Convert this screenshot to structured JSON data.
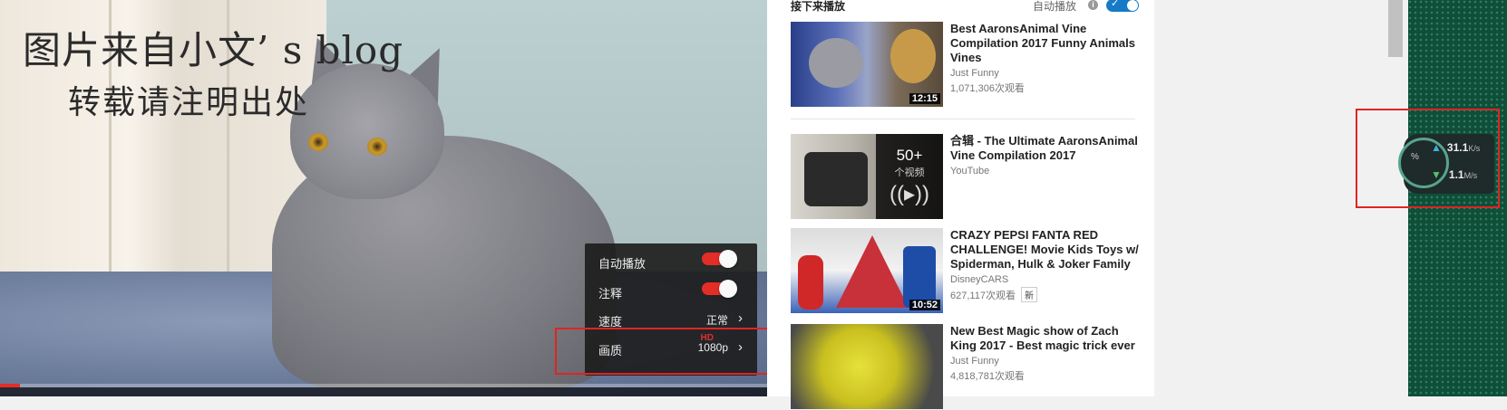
{
  "watermark": {
    "line1": "图片来自小文’ s blog",
    "line2": "转载请注明出处"
  },
  "settings": {
    "items": [
      {
        "label": "自动播放",
        "type": "toggle",
        "on": true
      },
      {
        "label": "注释",
        "type": "toggle",
        "on": true
      },
      {
        "label": "速度",
        "value": "正常"
      },
      {
        "label": "画质",
        "value": "1080p",
        "badge": "HD"
      }
    ]
  },
  "sidebar": {
    "up_next": "接下来播放",
    "autoplay_label": "自动播放",
    "videos": [
      {
        "title": "Best AaronsAnimal Vine Compilation 2017 Funny Animals Vines",
        "channel": "Just Funny",
        "views": "1,071,306次观看",
        "duration": "12:15"
      },
      {
        "title": "合辑 - The Ultimate AaronsAnimal Vine Compilation 2017",
        "channel": "YouTube",
        "views": "",
        "playlist_count": "50+",
        "playlist_label": "个视频"
      },
      {
        "title": "CRAZY PEPSI FANTA RED CHALLENGE! Movie Kids Toys w/ Spiderman, Hulk & Joker Family",
        "channel": "DisneyCARS",
        "views": "627,117次观看",
        "badge": "新",
        "duration": "10:52"
      },
      {
        "title": "New Best Magic show of Zach King 2017 - Best magic trick ever",
        "channel": "Just Funny",
        "views": "4,818,781次观看"
      }
    ]
  },
  "netmon": {
    "percent": "%",
    "up": "31.1",
    "up_unit": "K/s",
    "down": "1.1",
    "down_unit": "M/s"
  },
  "colors": {
    "accent_red": "#e52d27",
    "autoplay_blue": "#167ac6",
    "highlight_box": "#e02424"
  }
}
